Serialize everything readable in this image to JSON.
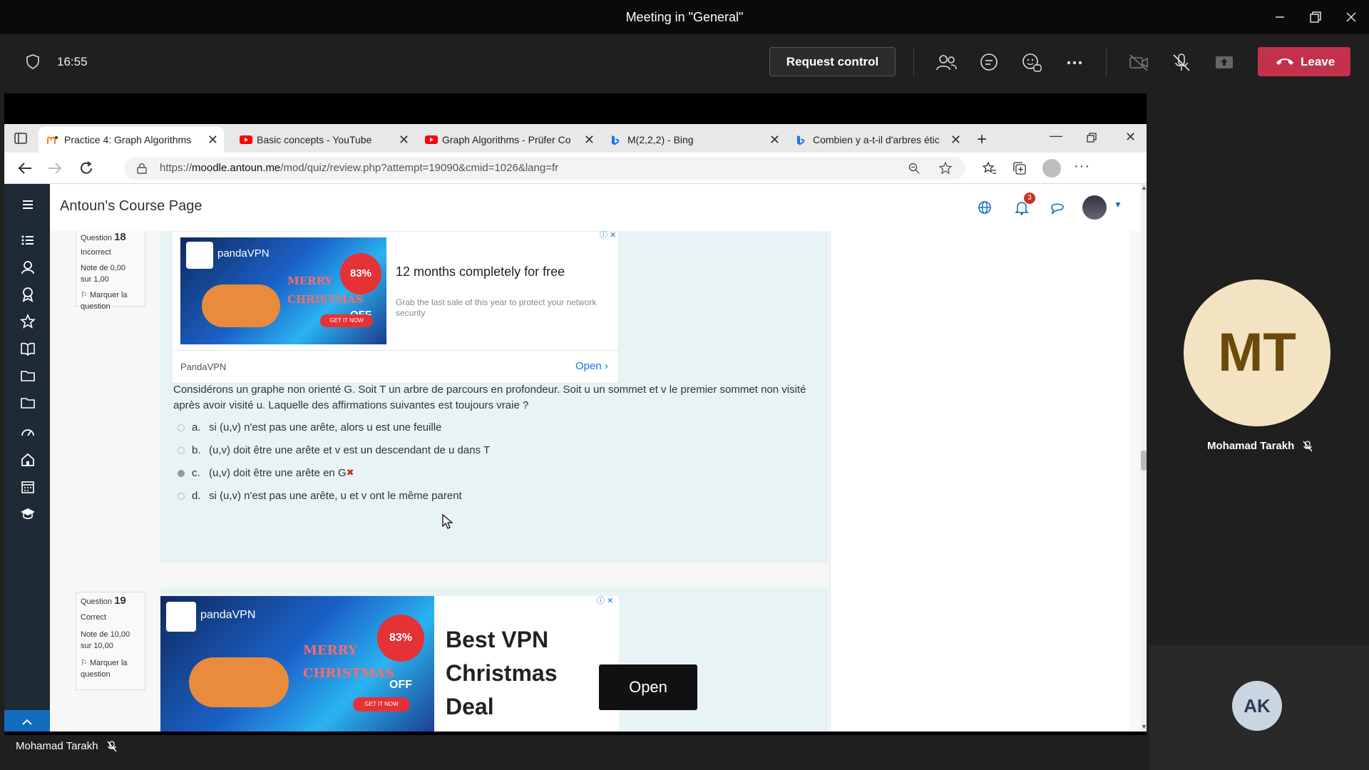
{
  "teams": {
    "window_title": "Meeting in \"General\"",
    "time": "16:55",
    "request_control": "Request control",
    "leave": "Leave"
  },
  "browser": {
    "tabs": [
      {
        "label": "Practice 4: Graph Algorithms",
        "icon": "moodle-icon"
      },
      {
        "label": "Basic concepts - YouTube",
        "icon": "youtube-icon"
      },
      {
        "label": "Graph Algorithms - Prüfer Co",
        "icon": "youtube-icon"
      },
      {
        "label": "M(2,2,2) - Bing",
        "icon": "bing-icon"
      },
      {
        "label": "Combien y a-t-il d'arbres étic",
        "icon": "bing-icon"
      }
    ],
    "url_prefix": "https://",
    "url_host": "moodle.antoun.me",
    "url_path": "/mod/quiz/review.php?attempt=19090&cmid=1026&lang=fr"
  },
  "moodle": {
    "site_name": "Antoun's Course Page",
    "notification_count": "3"
  },
  "q18": {
    "label": "Question",
    "number": "18",
    "status": "Incorrect",
    "grade_line1": "Note de 0,00",
    "grade_line2": "sur 1,00",
    "flag": "Marquer la question",
    "ad": {
      "brand_logo": "pandaVPN",
      "badge": "83% OFF",
      "merry": "MERRY",
      "christmas": "CHRISTMAS",
      "cta": "GET IT NOW",
      "headline": "12 months completely for free",
      "body": "Grab the last sale of this year to protect your network security",
      "advertiser": "PandaVPN",
      "open": "Open"
    },
    "text": "Considérons un graphe non orienté G. Soit T un arbre de parcours en profondeur. Soit u un sommet et v le premier sommet non visité après avoir visité u. Laquelle des affirmations suivantes est toujours vraie ?",
    "answers": [
      {
        "letter": "a.",
        "text": "si (u,v) n'est pas une arête, alors u est une feuille"
      },
      {
        "letter": "b.",
        "text": "(u,v) doit être une arête et v est un descendant de u dans T"
      },
      {
        "letter": "c.",
        "text": "(u,v) doit être une arête en G",
        "selected": true,
        "mark": "✖"
      },
      {
        "letter": "d.",
        "text": "si (u,v) n'est pas une arête, u et v ont le même parent"
      }
    ]
  },
  "q19": {
    "label": "Question",
    "number": "19",
    "status": "Correct",
    "grade_line1": "Note de 10,00",
    "grade_line2": "sur 10,00",
    "flag": "Marquer la question",
    "ad": {
      "brand_logo": "pandaVPN",
      "badge": "83% OFF",
      "merry": "MERRY",
      "christmas": "CHRISTMAS",
      "cta": "GET IT NOW",
      "headline_line1": "Best VPN",
      "headline_line2": "Christmas",
      "headline_line3": "Deal",
      "open": "Open"
    }
  },
  "participants": [
    {
      "initials": "MT",
      "name": "Mohamad Tarakh"
    },
    {
      "initials": "AK"
    }
  ],
  "share_presenter": "Mohamad Tarakh",
  "colors": {
    "leave": "#c4314b",
    "moodle_nav": "#1e2a35",
    "question_bg": "#e7f3f5",
    "incorrect": "#ca3120"
  }
}
